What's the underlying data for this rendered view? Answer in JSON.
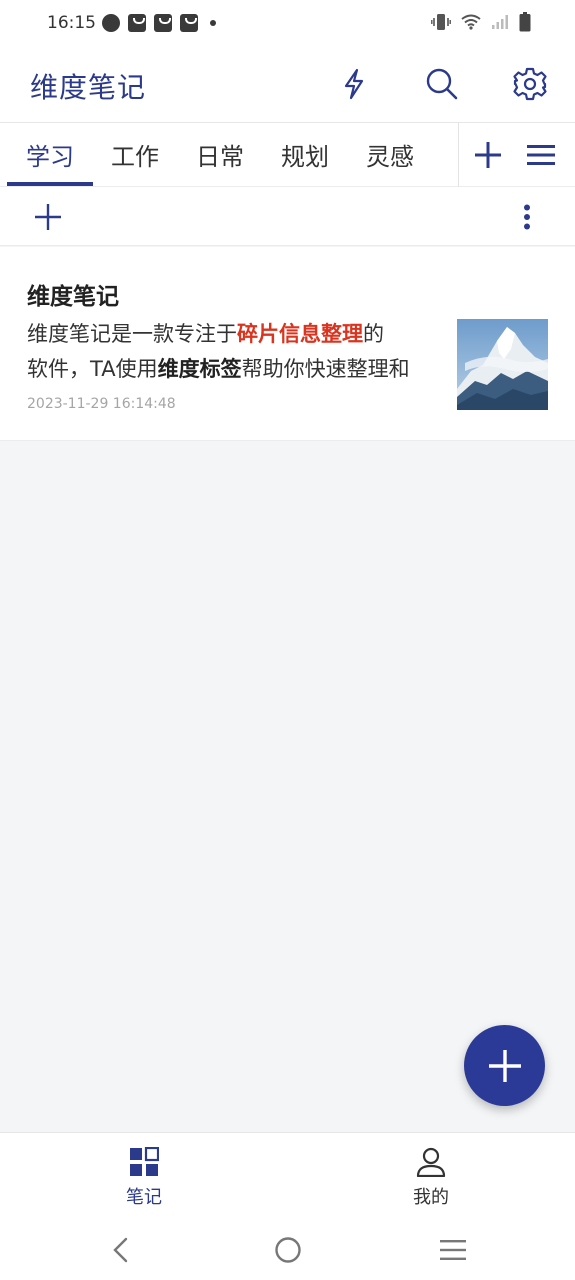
{
  "status_bar": {
    "time": "16:15"
  },
  "header": {
    "title": "维度笔记",
    "icons": [
      "flash-icon",
      "search-icon",
      "gear-icon"
    ]
  },
  "tabs": [
    {
      "label": "学习",
      "active": true
    },
    {
      "label": "工作",
      "active": false
    },
    {
      "label": "日常",
      "active": false
    },
    {
      "label": "规划",
      "active": false
    },
    {
      "label": "灵感",
      "active": false
    }
  ],
  "note": {
    "title": "维度笔记",
    "line1": {
      "pre": "维度笔记是一款专注于",
      "highlight": "碎片信息整理",
      "post": "的"
    },
    "line2": {
      "pre": "软件，TA使用",
      "bold": "维度标签",
      "post": "帮助你快速整理和"
    },
    "timestamp": "2023-11-29 16:14:48"
  },
  "bottom_nav": {
    "notes_label": "笔记",
    "me_label": "我的"
  },
  "colors": {
    "accent": "#2c3a8c",
    "highlight": "#d9341f",
    "background": "#f4f5f7"
  }
}
